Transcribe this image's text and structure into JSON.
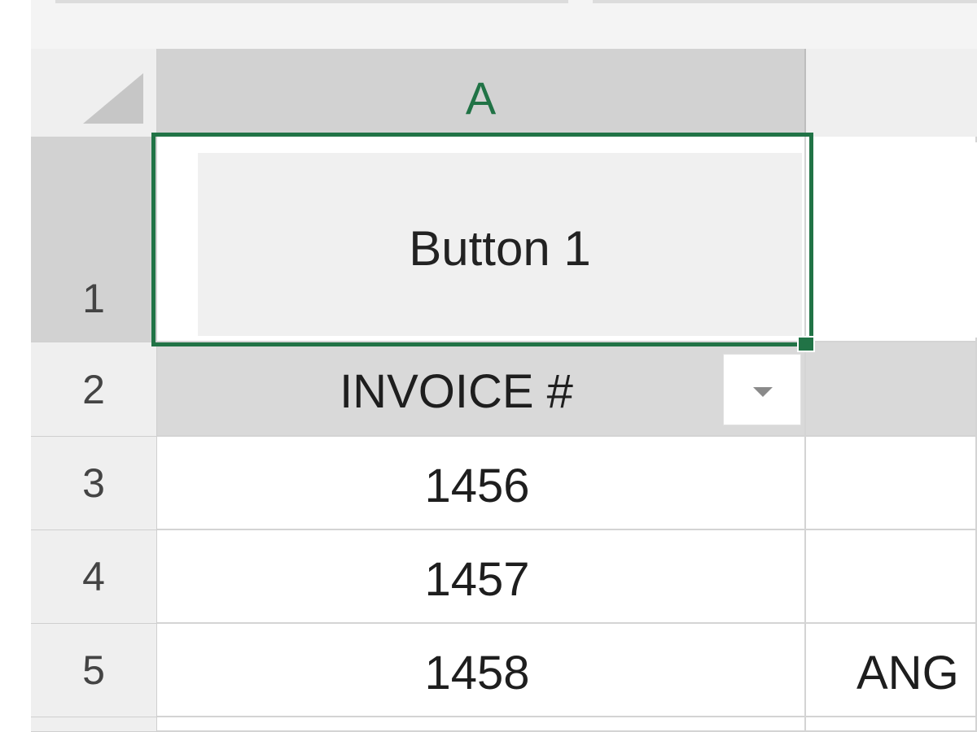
{
  "column_headers": [
    {
      "label": "A"
    }
  ],
  "row_headers": [
    "1",
    "2",
    "3",
    "4",
    "5"
  ],
  "button": {
    "label": "Button 1"
  },
  "cells": {
    "A2": "INVOICE #",
    "A3": "1456",
    "A4": "1457",
    "A5": "1458",
    "B5": "ANG"
  },
  "icons": {
    "select_all": "select-all-triangle-icon",
    "filter": "filter-dropdown-icon"
  },
  "colors": {
    "accent": "#217346",
    "header_bg": "#d2d2d2",
    "table_header_bg": "#d9d9d9",
    "button_bg": "#f0f0f0"
  }
}
